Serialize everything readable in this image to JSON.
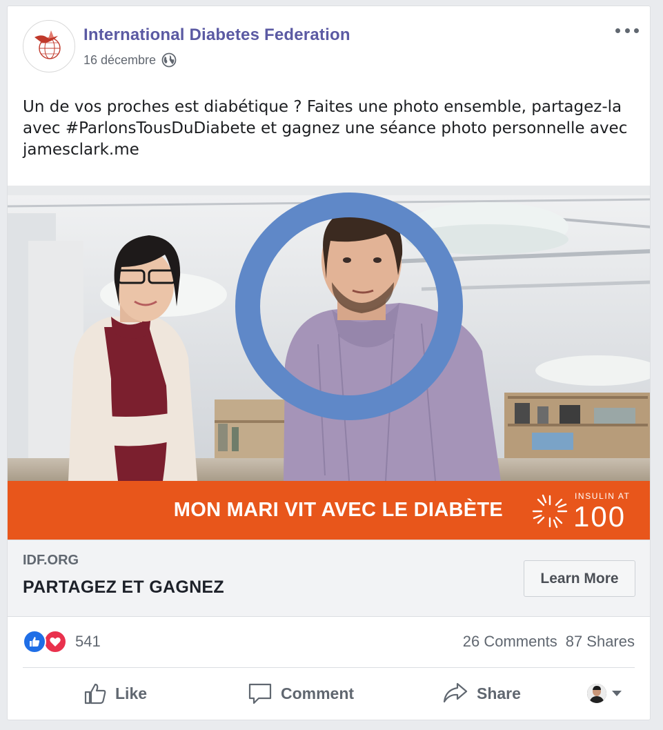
{
  "post": {
    "page_name": "International Diabetes Federation",
    "date": "16 décembre",
    "text": "Un de vos proches est diabétique ? Faites une photo ensemble, partagez-la avec #ParlonsTousDuDiabete et gagnez une séance photo personnelle avec jamesclark.me"
  },
  "banner": {
    "text": "MON MARI VIT AVEC LE DIABÈTE",
    "insulin_small": "INSULIN AT",
    "insulin_big": "100",
    "color": "#e8561b"
  },
  "link": {
    "domain": "IDF.ORG",
    "title": "PARTAGEZ ET GAGNEZ",
    "cta": "Learn More"
  },
  "stats": {
    "reactions": "541",
    "comments": "26 Comments",
    "shares": "87 Shares"
  },
  "actions": {
    "like": "Like",
    "comment": "Comment",
    "share": "Share"
  },
  "colors": {
    "brand": "#5b5aa3",
    "ring": "#5f88c8",
    "like": "#1f6ee6",
    "love": "#e9314d"
  },
  "icons": [
    "globe-icon",
    "more-icon",
    "like-reaction-icon",
    "love-reaction-icon",
    "thumbs-up-icon",
    "comment-icon",
    "share-icon",
    "viewer-avatar",
    "chevron-down-icon"
  ]
}
